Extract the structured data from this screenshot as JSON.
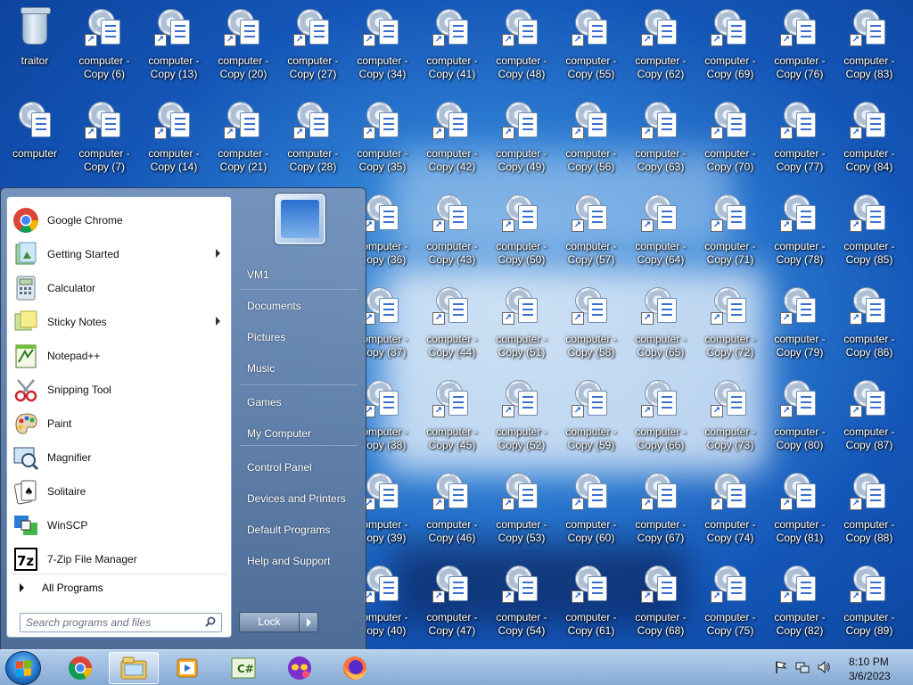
{
  "desktop": {
    "icons": [
      [
        "traitor",
        "computer - Copy (6)",
        "computer - Copy (13)",
        "computer - Copy (20)",
        "computer - Copy (27)",
        "computer - Copy (34)",
        "computer - Copy (41)",
        "computer - Copy (48)",
        "computer - Copy (55)",
        "computer - Copy (62)",
        "computer - Copy (69)",
        "computer - Copy (76)",
        "computer - Copy (83)"
      ],
      [
        "computer",
        "computer - Copy (7)",
        "computer - Copy (14)",
        "computer - Copy (21)",
        "computer - Copy (28)",
        "computer - Copy (35)",
        "computer - Copy (42)",
        "computer - Copy (49)",
        "computer - Copy (56)",
        "computer - Copy (63)",
        "computer - Copy (70)",
        "computer - Copy (77)",
        "computer - Copy (84)"
      ],
      [
        "",
        "",
        "",
        "",
        "",
        "computer - Copy (36)",
        "computer - Copy (43)",
        "computer - Copy (50)",
        "computer - Copy (57)",
        "computer - Copy (64)",
        "computer - Copy (71)",
        "computer - Copy (78)",
        "computer - Copy (85)"
      ],
      [
        "",
        "",
        "",
        "",
        "",
        "computer - Copy (37)",
        "computer - Copy (44)",
        "computer - Copy (51)",
        "computer - Copy (58)",
        "computer - Copy (65)",
        "computer - Copy (72)",
        "computer - Copy (79)",
        "computer - Copy (86)"
      ],
      [
        "",
        "",
        "",
        "",
        "",
        "computer - Copy (38)",
        "computer - Copy (45)",
        "computer - Copy (52)",
        "computer - Copy (59)",
        "computer - Copy (66)",
        "computer - Copy (73)",
        "computer - Copy (80)",
        "computer - Copy (87)"
      ],
      [
        "",
        "",
        "",
        "",
        "",
        "computer - Copy (39)",
        "computer - Copy (46)",
        "computer - Copy (53)",
        "computer - Copy (60)",
        "computer - Copy (67)",
        "computer - Copy (74)",
        "computer - Copy (81)",
        "computer - Copy (88)"
      ],
      [
        "",
        "",
        "",
        "",
        "",
        "computer - Copy (40)",
        "computer - Copy (47)",
        "computer - Copy (54)",
        "computer - Copy (61)",
        "computer - Copy (68)",
        "computer - Copy (75)",
        "computer - Copy (82)",
        "computer - Copy (89)"
      ]
    ]
  },
  "start_menu": {
    "pinned": [
      {
        "label": "Google Chrome",
        "icon": "chrome-icon",
        "submenu": false
      },
      {
        "label": "Getting Started",
        "icon": "getting-started-icon",
        "submenu": true
      },
      {
        "label": "Calculator",
        "icon": "calculator-icon",
        "submenu": false
      },
      {
        "label": "Sticky Notes",
        "icon": "sticky-notes-icon",
        "submenu": true
      },
      {
        "label": "Notepad++",
        "icon": "notepadpp-icon",
        "submenu": false
      },
      {
        "label": "Snipping Tool",
        "icon": "snipping-tool-icon",
        "submenu": false
      },
      {
        "label": "Paint",
        "icon": "paint-icon",
        "submenu": false
      },
      {
        "label": "Magnifier",
        "icon": "magnifier-icon",
        "submenu": false
      },
      {
        "label": "Solitaire",
        "icon": "solitaire-icon",
        "submenu": false
      },
      {
        "label": "WinSCP",
        "icon": "winscp-icon",
        "submenu": false
      },
      {
        "label": "7-Zip File Manager",
        "icon": "7zip-icon",
        "submenu": false
      }
    ],
    "all_programs": "All Programs",
    "search_placeholder": "Search programs and files",
    "places": [
      "VM1",
      "Documents",
      "Pictures",
      "Music",
      "Games",
      "My Computer",
      "Control Panel",
      "Devices and Printers",
      "Default Programs",
      "Help and Support"
    ],
    "lock_label": "Lock"
  },
  "taskbar": {
    "pinned": [
      "chrome-icon",
      "file-explorer-icon",
      "media-player-icon",
      "csharp-icon",
      "privacy-app-icon",
      "firefox-icon"
    ],
    "time": "8:10 PM",
    "date": "3/6/2023"
  },
  "colors": {
    "wallpaper": "#1456b8",
    "taskbar": "#a9c4e4",
    "start_menu_left": "#ffffff"
  }
}
